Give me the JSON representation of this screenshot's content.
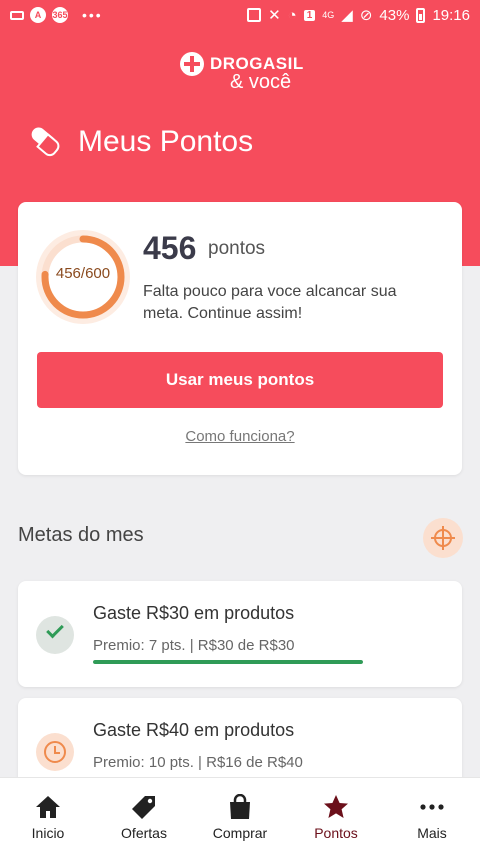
{
  "status_bar": {
    "battery": "43%",
    "time": "19:16",
    "network": "4G",
    "notif_badge": "1",
    "app_badges": [
      "A",
      "365"
    ]
  },
  "brand": {
    "name": "DROGASIL",
    "subtitle": "& você"
  },
  "page": {
    "title": "Meus Pontos"
  },
  "points": {
    "current": 456,
    "goal": 600,
    "ring_label": "456/600",
    "number": "456",
    "unit": "pontos",
    "message": "Falta pouco para voce alcancar sua meta. Continue assim!",
    "use_button": "Usar meus pontos",
    "how_link": "Como funciona?"
  },
  "goals_section": {
    "title": "Metas do mes"
  },
  "goals": [
    {
      "title": "Gaste R$30 em produtos",
      "subtitle": "Premio: 7 pts. | R$30 de R$30",
      "progress": 1.0,
      "status": "done"
    },
    {
      "title": "Gaste R$40 em produtos",
      "subtitle": "Premio: 10 pts. | R$16 de R$40",
      "progress": 0.4,
      "status": "pending"
    }
  ],
  "tabs": [
    {
      "label": "Inicio",
      "icon": "home-icon"
    },
    {
      "label": "Ofertas",
      "icon": "tag-icon"
    },
    {
      "label": "Comprar",
      "icon": "shopping-bag-icon"
    },
    {
      "label": "Pontos",
      "icon": "star-icon",
      "active": true
    },
    {
      "label": "Mais",
      "icon": "more-icon"
    }
  ],
  "colors": {
    "brand": "#f64c5c",
    "success": "#2f9b57",
    "accent": "#ef8a4c",
    "active_tab": "#6b0f1a"
  }
}
